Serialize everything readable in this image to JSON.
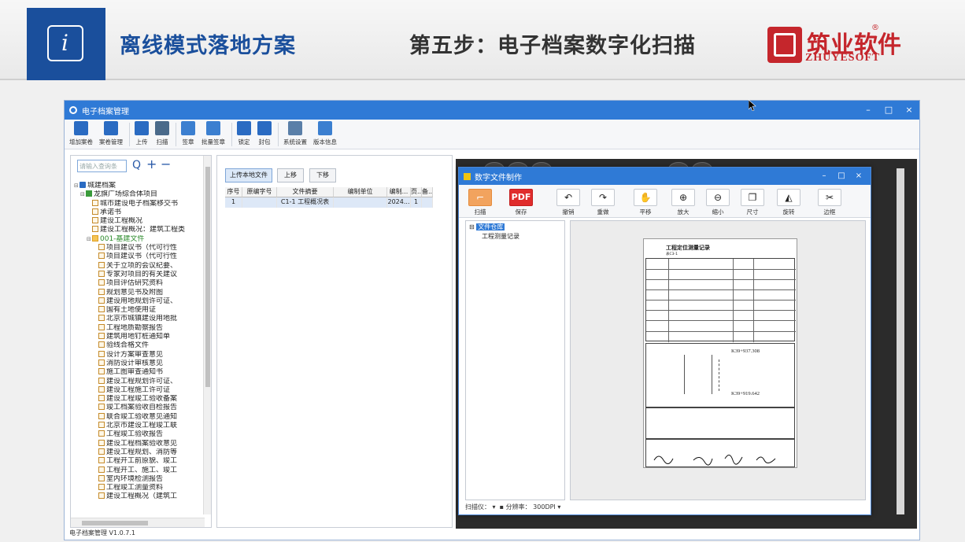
{
  "slide": {
    "title_left": "离线模式落地方案",
    "title_center": "第五步：电子档案数字化扫描",
    "logo_cn": "筑业软件",
    "logo_en": "ZHUYESOFT",
    "logo_reg": "®",
    "brand_color": "#1a4f9c",
    "logo_color": "#c5262c"
  },
  "app": {
    "title": "电子档案管理",
    "controls": [
      "–",
      "□",
      "×"
    ],
    "toolbar": [
      {
        "label": "增加案卷",
        "icon": "add-folder-icon"
      },
      {
        "label": "案卷管理",
        "icon": "folder-manage-icon"
      },
      {
        "label": "上传",
        "icon": "upload-icon"
      },
      {
        "label": "扫描",
        "icon": "scanner-icon"
      },
      {
        "label": "签章",
        "icon": "stamp-icon"
      },
      {
        "label": "批量签章",
        "icon": "batch-stamp-icon"
      },
      {
        "label": "锁定",
        "icon": "lock-icon"
      },
      {
        "label": "封包",
        "icon": "package-icon"
      },
      {
        "label": "系统设置",
        "icon": "settings-icon"
      },
      {
        "label": "版本信息",
        "icon": "info-icon"
      }
    ],
    "search_placeholder": "请输入查询条",
    "tree": [
      {
        "label": "城建档案",
        "level": 0,
        "icon": "home",
        "exp": "⊟"
      },
      {
        "label": "龙旗广场综合体项目",
        "level": 1,
        "icon": "house",
        "exp": "⊟"
      },
      {
        "label": "城市建设电子档案移交书",
        "level": 2,
        "icon": "doc"
      },
      {
        "label": "承诺书",
        "level": 2,
        "icon": "doc"
      },
      {
        "label": "建设工程概况",
        "level": 2,
        "icon": "doc"
      },
      {
        "label": "建设工程概况：建筑工程类",
        "level": 2,
        "icon": "doc"
      },
      {
        "label": "001-基建文件",
        "level": 2,
        "icon": "folder",
        "exp": "⊟",
        "green": true
      },
      {
        "label": "项目建议书（代可行性",
        "level": 3,
        "icon": "doc"
      },
      {
        "label": "项目建议书（代可行性",
        "level": 3,
        "icon": "doc"
      },
      {
        "label": "关于立项的会议纪要、",
        "level": 3,
        "icon": "doc"
      },
      {
        "label": "专家对项目的有关建议",
        "level": 3,
        "icon": "doc"
      },
      {
        "label": "项目评估研究资料",
        "level": 3,
        "icon": "doc"
      },
      {
        "label": "规划意见书及附图",
        "level": 3,
        "icon": "doc"
      },
      {
        "label": "建设用地规划许可证、",
        "level": 3,
        "icon": "doc"
      },
      {
        "label": "国有土地使用证",
        "level": 3,
        "icon": "doc"
      },
      {
        "label": "北京市城镇建设用地批",
        "level": 3,
        "icon": "doc"
      },
      {
        "label": "工程地质勘察报告",
        "level": 3,
        "icon": "doc"
      },
      {
        "label": "建筑用地钉桩通知单",
        "level": 3,
        "icon": "doc"
      },
      {
        "label": "验线合格文件",
        "level": 3,
        "icon": "doc"
      },
      {
        "label": "设计方案审查意见",
        "level": 3,
        "icon": "doc"
      },
      {
        "label": "消防设计审核意见",
        "level": 3,
        "icon": "doc"
      },
      {
        "label": "施工图审查通知书",
        "level": 3,
        "icon": "doc"
      },
      {
        "label": "建设工程规划许可证、",
        "level": 3,
        "icon": "doc"
      },
      {
        "label": "建设工程施工许可证",
        "level": 3,
        "icon": "doc"
      },
      {
        "label": "建设工程竣工验收备案",
        "level": 3,
        "icon": "doc"
      },
      {
        "label": "竣工档案验收自检报告",
        "level": 3,
        "icon": "doc"
      },
      {
        "label": "联合竣工验收意见通知",
        "level": 3,
        "icon": "doc"
      },
      {
        "label": "北京市建设工程竣工联",
        "level": 3,
        "icon": "doc"
      },
      {
        "label": "工程竣工验收报告",
        "level": 3,
        "icon": "doc"
      },
      {
        "label": "建设工程档案验收意见",
        "level": 3,
        "icon": "doc"
      },
      {
        "label": "建设工程规划、消防等",
        "level": 3,
        "icon": "doc"
      },
      {
        "label": "工程开工前原貌、竣工",
        "level": 3,
        "icon": "doc"
      },
      {
        "label": "工程开工、施工、竣工",
        "level": 3,
        "icon": "doc"
      },
      {
        "label": "室内环境检测报告",
        "level": 3,
        "icon": "doc"
      },
      {
        "label": "工程竣工测量资料",
        "level": 3,
        "icon": "doc"
      },
      {
        "label": "建设工程概况（建筑工",
        "level": 3,
        "icon": "doc"
      }
    ],
    "status": "电子档案管理  V1.0.7.1",
    "mid_buttons": [
      "上传本地文件",
      "上移",
      "下移"
    ],
    "grid_headers": [
      "序号",
      "原编字号",
      "文件摘要",
      "编制单位",
      "编制...",
      "页...",
      "备..."
    ],
    "grid_rows": [
      [
        "1",
        "",
        "C1-1 工程概况表",
        "",
        "2024...",
        "1",
        ""
      ]
    ]
  },
  "dialog": {
    "title": "数字文件制作",
    "controls": [
      "–",
      "□",
      "×"
    ],
    "toolbar": [
      {
        "label": "扫描",
        "icon": "scan-icon",
        "glyph": "⌐"
      },
      {
        "label": "保存",
        "icon": "pdf-icon",
        "glyph": "PDF"
      },
      {
        "label": "撤销",
        "icon": "undo-icon",
        "glyph": "↶"
      },
      {
        "label": "重做",
        "icon": "redo-icon",
        "glyph": "↷"
      },
      {
        "label": "平移",
        "icon": "hand-icon",
        "glyph": "✋"
      },
      {
        "label": "放大",
        "icon": "zoom-in-icon",
        "glyph": "⊕"
      },
      {
        "label": "缩小",
        "icon": "zoom-out-icon",
        "glyph": "⊖"
      },
      {
        "label": "尺寸",
        "icon": "resize-icon",
        "glyph": "❐"
      },
      {
        "label": "旋转",
        "icon": "rotate-icon",
        "glyph": "◭"
      },
      {
        "label": "边框",
        "icon": "crop-icon",
        "glyph": "✂"
      }
    ],
    "tree_root": "文件仓库",
    "tree_child": "工程测量记录",
    "status_label": "扫描仪：",
    "resolution_label": "分辨率：",
    "resolution_value": "300DPI",
    "document": {
      "title": "工程定位测量记录",
      "subtitle": "表C3-1",
      "mark1": "K39+937.308",
      "mark2": "K39+919.642"
    }
  }
}
